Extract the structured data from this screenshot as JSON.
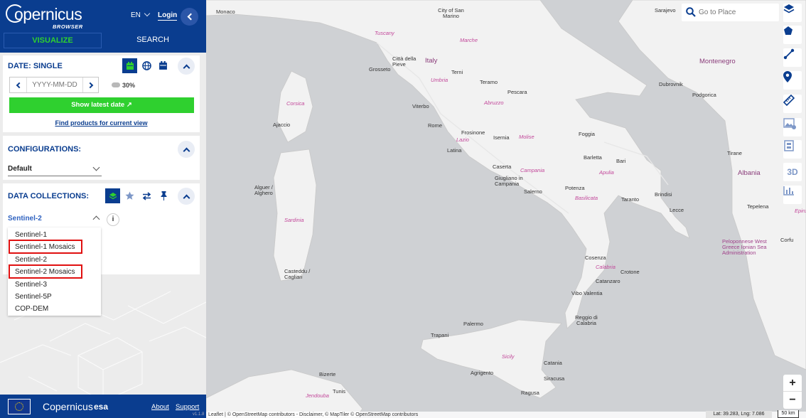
{
  "brand": {
    "name": "opernicus",
    "sub": "BROWSER"
  },
  "header": {
    "lang": "EN",
    "login": "Login",
    "tab_visualize": "VISUALIZE",
    "tab_search": "SEARCH"
  },
  "date_panel": {
    "title": "DATE: SINGLE",
    "placeholder": "YYYY-MM-DD",
    "cloud": "30%",
    "latest_btn": "Show latest date  ↗",
    "find_link": "Find products for current view"
  },
  "config_panel": {
    "title": "CONFIGURATIONS:",
    "selected": "Default"
  },
  "data_panel": {
    "title": "DATA COLLECTIONS:",
    "selected": "Sentinel-2",
    "info": "i",
    "options": [
      "Sentinel-1",
      "Sentinel-1 Mosaics",
      "Sentinel-2",
      "Sentinel-2 Mosaics",
      "Sentinel-3",
      "Sentinel-5P",
      "COP-DEM"
    ]
  },
  "footer": {
    "copernicus": "Copernicus",
    "esa": "esa",
    "about": "About",
    "support": "Support",
    "version": "v1.1.8"
  },
  "map": {
    "search_placeholder": "Go to Place",
    "tool_3d": "3D",
    "zoom_in": "+",
    "zoom_out": "−",
    "attribution": "Leaflet | © OpenStreetMap contributors - Disclaimer, © MapTiler © OpenStreetMap contributors",
    "coords": "Lat: 39.283, Lng: 7.086",
    "scale": "50 km",
    "countries": [
      "Italy",
      "Montenegro",
      "Albania"
    ],
    "regions": [
      "Tuscany",
      "Marche",
      "Umbria",
      "Abruzzo",
      "Lazio",
      "Molise",
      "Campania",
      "Apulia",
      "Basilicata",
      "Calabria",
      "Sicily",
      "Corsica",
      "Sardinia",
      "Jendouba",
      "Epiru"
    ],
    "cities": [
      "Monaco",
      "City of San Marino",
      "Sarajevo",
      "Grosseto",
      "Città della Pieve",
      "Terni",
      "Teramo",
      "Viterbo",
      "Pescara",
      "Rome",
      "Frosinone",
      "Isernia",
      "Foggia",
      "Latina",
      "Caserta",
      "Giugliano in Campania",
      "Salerno",
      "Potenza",
      "Barletta",
      "Bari",
      "Taranto",
      "Brindisi",
      "Lecce",
      "Tirane",
      "Dubrovnik",
      "Podgorica",
      "Tepelena",
      "Corfu",
      "Cosenza",
      "Crotone",
      "Catanzaro",
      "Vibo Valentia",
      "Reggio di Calabria",
      "Palermo",
      "Trapani",
      "Agrigento",
      "Catania",
      "Siracusa",
      "Ragusa",
      "Ajaccio",
      "Alguer / Alghero",
      "Casteddu / Cagliari",
      "Bizerte",
      "Tunis"
    ],
    "sea_label": "Peloponnese West Greece Ionian Sea Administration"
  }
}
